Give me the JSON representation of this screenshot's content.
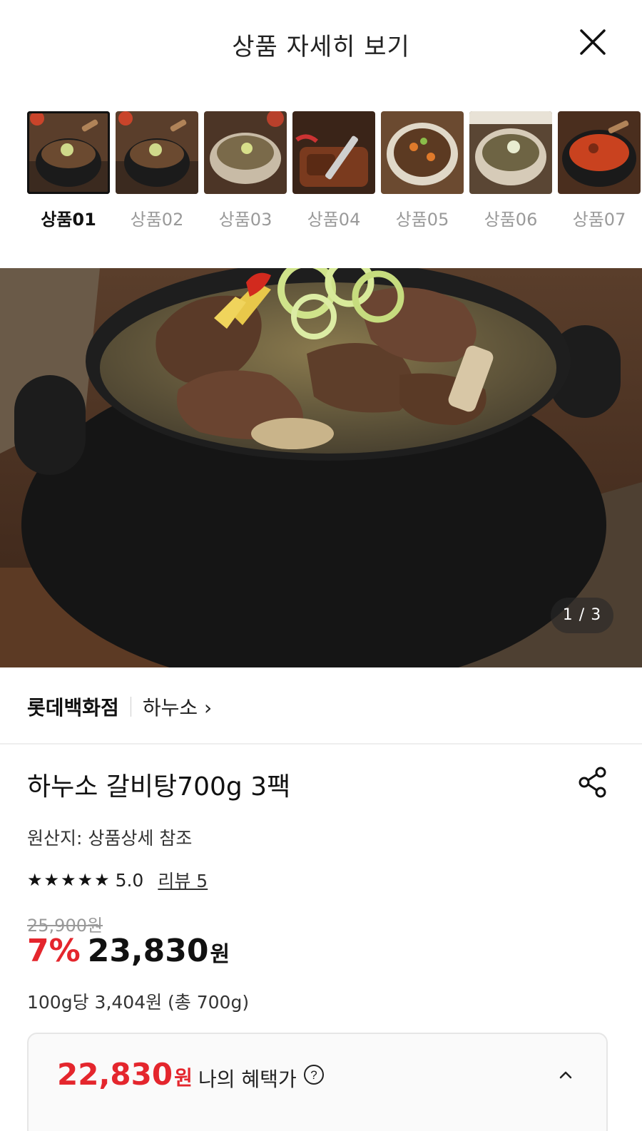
{
  "header": {
    "title": "상품 자세히 보기"
  },
  "thumbnails": [
    {
      "label": "상품01"
    },
    {
      "label": "상품02"
    },
    {
      "label": "상품03"
    },
    {
      "label": "상품04"
    },
    {
      "label": "상품05"
    },
    {
      "label": "상품06"
    },
    {
      "label": "상품07"
    }
  ],
  "gallery": {
    "pager": "1 / 3"
  },
  "brand": {
    "store": "롯데백화점",
    "name": "하누소 ›"
  },
  "product": {
    "title": "하누소 갈비탕700g 3팩",
    "origin": "원산지: 상품상세 참조",
    "rating": "5.0",
    "review_link": "리뷰 5",
    "original_price": "25,900원",
    "discount": "7%",
    "price": "23,830",
    "price_unit": "원",
    "unit_price": "100g당 3,404원 (총 700g)"
  },
  "benefit": {
    "price": "22,830",
    "price_unit": "원",
    "label": "나의 혜택가"
  },
  "colors": {
    "accent_red": "#e4262d",
    "text": "#111111",
    "muted": "#9a9a9a"
  }
}
